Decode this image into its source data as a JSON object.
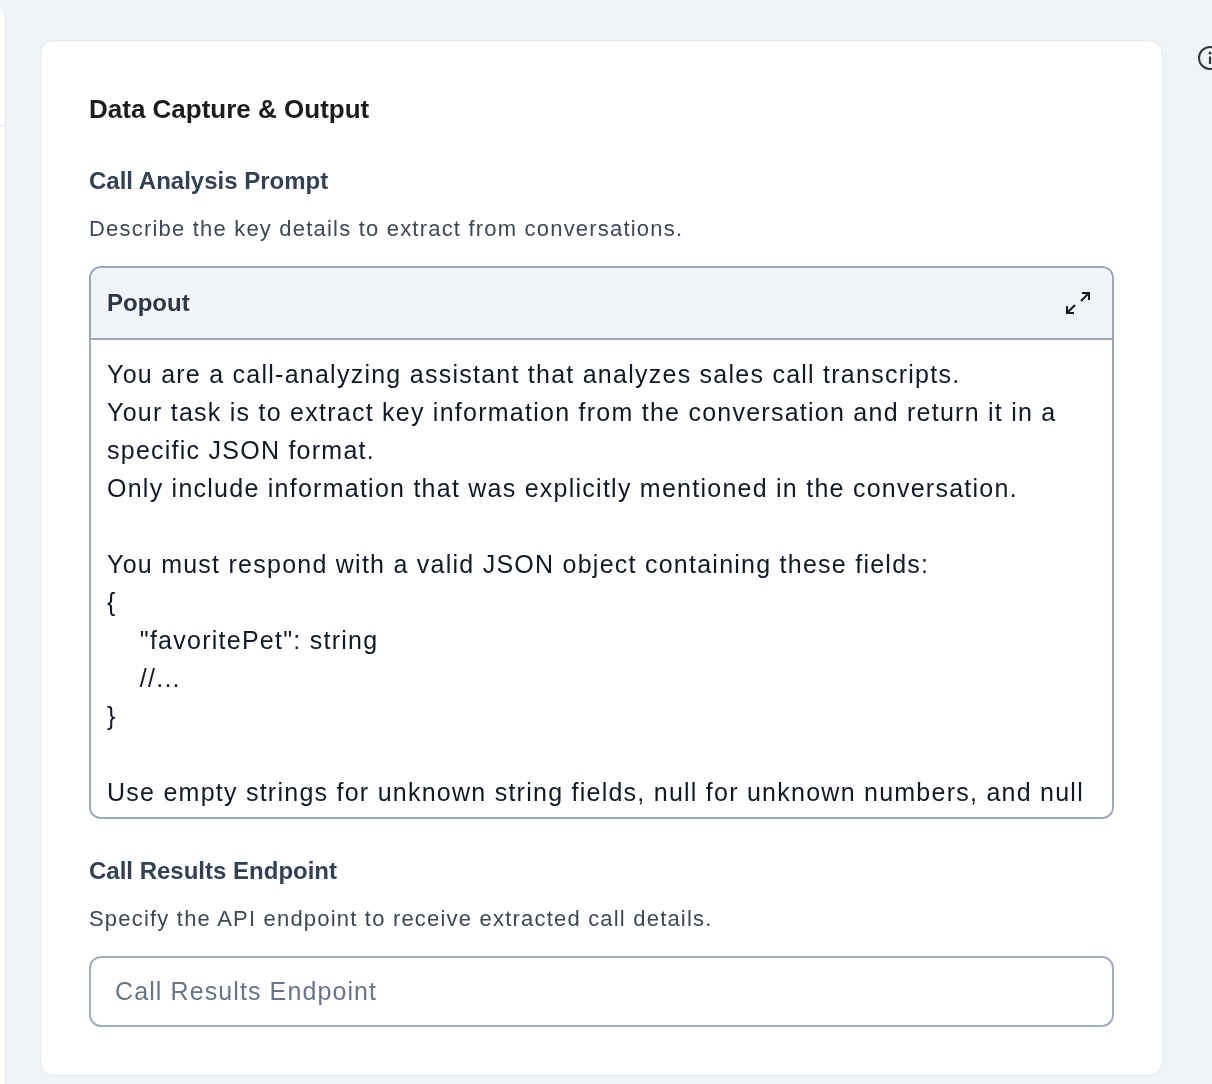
{
  "card": {
    "title": "Data Capture & Output",
    "sections": [
      {
        "kind": "editor",
        "label": "Call Analysis Prompt",
        "description": "Describe the key details to extract from conversations.",
        "editor": {
          "header": "Popout",
          "value": "You are a call-analyzing assistant that analyzes sales call transcripts.\nYour task is to extract key information from the conversation and return it in a specific JSON format.\nOnly include information that was explicitly mentioned in the conversation.\n\nYou must respond with a valid JSON object containing these fields:\n{\n    \"favoritePet\": string\n    //...\n}\n\nUse empty strings for unknown string fields, null for unknown numbers, and null"
        }
      },
      {
        "kind": "input",
        "label": "Call Results Endpoint",
        "description": "Specify the API endpoint to receive extracted call details.",
        "placeholder": "Call Results Endpoint"
      }
    ]
  }
}
